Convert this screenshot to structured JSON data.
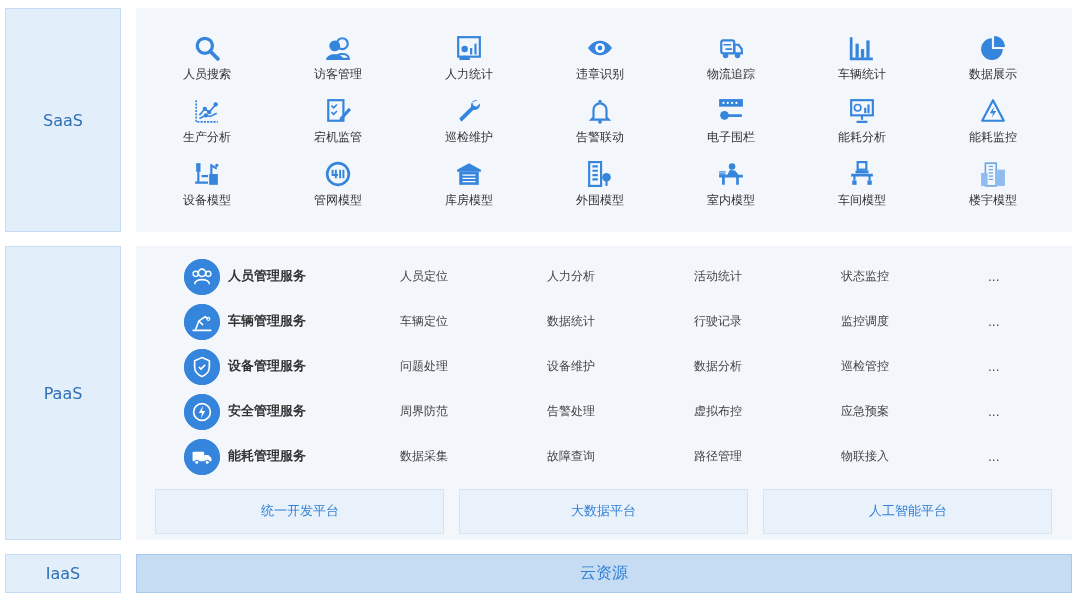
{
  "layers": [
    {
      "label": "SaaS",
      "kind": "apps",
      "apps": [
        {
          "label": "人员搜索"
        },
        {
          "label": "访客管理"
        },
        {
          "label": "人力统计"
        },
        {
          "label": "违章识别"
        },
        {
          "label": "物流追踪"
        },
        {
          "label": "车辆统计"
        },
        {
          "label": "数据展示"
        },
        {
          "label": "生产分析"
        },
        {
          "label": "宕机监管"
        },
        {
          "label": "巡检维护"
        },
        {
          "label": "告警联动"
        },
        {
          "label": "电子围栏"
        },
        {
          "label": "能耗分析"
        },
        {
          "label": "能耗监控"
        },
        {
          "label": "设备模型"
        },
        {
          "label": "管网模型"
        },
        {
          "label": "库房模型"
        },
        {
          "label": "外围模型"
        },
        {
          "label": "室内模型"
        },
        {
          "label": "车间模型"
        },
        {
          "label": "楼宇模型"
        }
      ]
    },
    {
      "label": "PaaS",
      "kind": "services",
      "services": [
        {
          "name": "人员管理服务",
          "items": [
            "人员定位",
            "人力分析",
            "活动统计",
            "状态监控",
            "..."
          ]
        },
        {
          "name": "车辆管理服务",
          "items": [
            "车辆定位",
            "数据统计",
            "行驶记录",
            "监控调度",
            "..."
          ]
        },
        {
          "name": "设备管理服务",
          "items": [
            "问题处理",
            "设备维护",
            "数据分析",
            "巡检管控",
            "..."
          ]
        },
        {
          "name": "安全管理服务",
          "items": [
            "周界防范",
            "告警处理",
            "虚拟布控",
            "应急预案",
            "..."
          ]
        },
        {
          "name": "能耗管理服务",
          "items": [
            "数据采集",
            "故障查询",
            "路径管理",
            "物联接入",
            "..."
          ]
        }
      ],
      "platforms": [
        "统一开发平台",
        "大数据平台",
        "人工智能平台"
      ]
    },
    {
      "label": "IaaS",
      "kind": "resource",
      "resource": "云资源"
    }
  ]
}
